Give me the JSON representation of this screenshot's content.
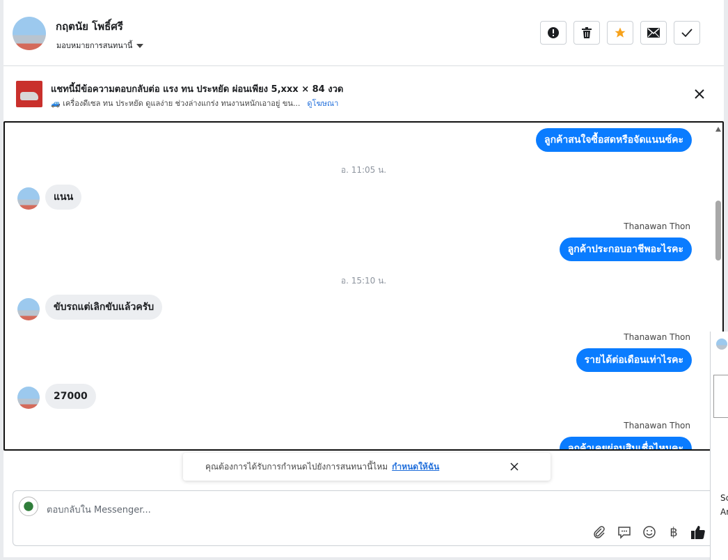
{
  "header": {
    "contact_name": "กฤตนัย โพธิ์ศรี",
    "assign_label": "มอบหมายการสนทนานี้",
    "actions": [
      {
        "name": "spam-button",
        "icon": "exclamation-icon"
      },
      {
        "name": "delete-button",
        "icon": "trash-icon"
      },
      {
        "name": "star-button",
        "icon": "star-icon",
        "color": "#f7a21b"
      },
      {
        "name": "mark-unread-button",
        "icon": "envelope-icon"
      },
      {
        "name": "mark-done-button",
        "icon": "checkmark-icon"
      }
    ]
  },
  "ad": {
    "title": "แชทนี้มีข้อความตอบกลับต่อ แรง ทน ประหยัด ผ่อนเพียง 5,xxx × 84 งวด",
    "description": "🚙 เครื่องดีเซล ทน ประหยัด ดูแลง่าย ช่วงล่างแกร่ง ทนงานหนักเอาอยู่ ขน...",
    "link": "ดูโฆษณา"
  },
  "conversation": {
    "msg1": "ลูกค้าสนใจซื้อสดหรือจัดแนนซ์คะ",
    "ts1": "อ. 11:05 น.",
    "msg2": "แนน",
    "sender1": "Thanawan Thon",
    "msg3": "ลูกค้าประกอบอาชีพอะไรคะ",
    "ts2": "อ. 15:10 น.",
    "msg4": "ขับรถแต่เลิกขับแล้วครับ",
    "sender2": "Thanawan Thon",
    "msg5": "รายได้ต่อเดือนเท่าไรคะ",
    "msg6": "27000",
    "sender3": "Thanawan Thon",
    "msg7": "ลูกค้าเคยผ่อนสินเชื่อไหมคะ"
  },
  "notice": {
    "text": "คุณต้องการได้รับการกำหนดไปยังการสนทนานี้ไหม",
    "link": "กำหนดให้ฉัน"
  },
  "composer": {
    "placeholder": "ตอบกลับใน Messenger...",
    "icons": [
      "paperclip-icon",
      "saved-reply-icon",
      "emoji-icon",
      "baht-icon",
      "thumbs-up-icon"
    ]
  },
  "side_panel": {
    "text1": "Sc",
    "text2": "Ar"
  },
  "colors": {
    "outgoing_bubble": "#0a7cff",
    "incoming_bubble": "#eceef1",
    "link": "#216fdb",
    "star": "#f7a21b"
  }
}
